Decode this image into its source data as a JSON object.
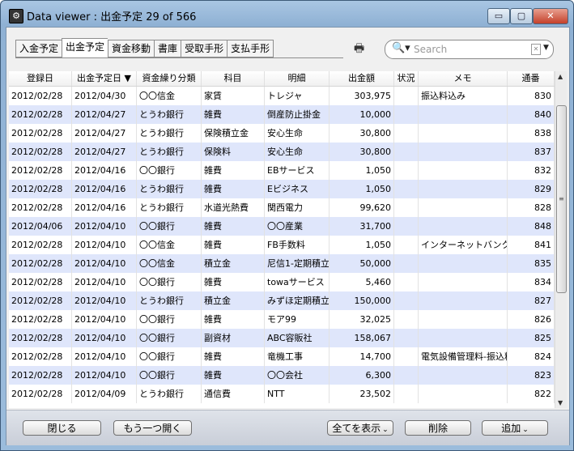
{
  "window": {
    "title": "Data viewer : 出金予定 29 of 566",
    "min_label": "▭",
    "max_label": "▢",
    "close_label": "✕"
  },
  "tabs": [
    "入金予定",
    "出金予定",
    "資金移動",
    "書庫",
    "受取手形",
    "支払手形"
  ],
  "active_tab": 1,
  "search": {
    "placeholder": "Search"
  },
  "columns": [
    "登録日",
    "出金予定日 ▼",
    "資金繰り分類",
    "科目",
    "明細",
    "出金額",
    "状況",
    "メモ",
    "通番"
  ],
  "rows": [
    [
      "2012/02/28",
      "2012/04/30",
      "〇〇信金",
      "家賃",
      "トレジャ",
      "303,975",
      "",
      "振込料込み",
      "830"
    ],
    [
      "2012/02/28",
      "2012/04/27",
      "とうわ銀行",
      "雑費",
      "倒産防止掛金",
      "10,000",
      "",
      "",
      "840"
    ],
    [
      "2012/02/28",
      "2012/04/27",
      "とうわ銀行",
      "保険積立金",
      "安心生命",
      "30,800",
      "",
      "",
      "838"
    ],
    [
      "2012/02/28",
      "2012/04/27",
      "とうわ銀行",
      "保険料",
      "安心生命",
      "30,800",
      "",
      "",
      "837"
    ],
    [
      "2012/02/28",
      "2012/04/16",
      "〇〇銀行",
      "雑費",
      "EBサービス",
      "1,050",
      "",
      "",
      "832"
    ],
    [
      "2012/02/28",
      "2012/04/16",
      "とうわ銀行",
      "雑費",
      "Eビジネス",
      "1,050",
      "",
      "",
      "829"
    ],
    [
      "2012/02/28",
      "2012/04/16",
      "とうわ銀行",
      "水道光熱費",
      "関西電力",
      "99,620",
      "",
      "",
      "828"
    ],
    [
      "2012/04/06",
      "2012/04/10",
      "〇〇銀行",
      "雑費",
      "〇〇産業",
      "31,700",
      "",
      "",
      "848"
    ],
    [
      "2012/02/28",
      "2012/04/10",
      "〇〇信金",
      "雑費",
      "FB手数料",
      "1,050",
      "",
      "インターネットバンク",
      "841"
    ],
    [
      "2012/02/28",
      "2012/04/10",
      "〇〇信金",
      "積立金",
      "尼信1-定期積立",
      "50,000",
      "",
      "",
      "835"
    ],
    [
      "2012/02/28",
      "2012/04/10",
      "〇〇銀行",
      "雑費",
      "towaサービス",
      "5,460",
      "",
      "",
      "834"
    ],
    [
      "2012/02/28",
      "2012/04/10",
      "とうわ銀行",
      "積立金",
      "みずほ定期積立",
      "150,000",
      "",
      "",
      "827"
    ],
    [
      "2012/02/28",
      "2012/04/10",
      "〇〇銀行",
      "雑費",
      "モア99",
      "32,025",
      "",
      "",
      "826"
    ],
    [
      "2012/02/28",
      "2012/04/10",
      "〇〇銀行",
      "副資材",
      "ABC容販社",
      "158,067",
      "",
      "",
      "825"
    ],
    [
      "2012/02/28",
      "2012/04/10",
      "〇〇銀行",
      "雑費",
      "竜機工事",
      "14,700",
      "",
      "電気設備管理料-振込料",
      "824"
    ],
    [
      "2012/02/28",
      "2012/04/10",
      "〇〇銀行",
      "雑費",
      "〇〇会社",
      "6,300",
      "",
      "",
      "823"
    ],
    [
      "2012/02/28",
      "2012/04/09",
      "とうわ銀行",
      "通信費",
      "NTT",
      "23,502",
      "",
      "",
      "822"
    ]
  ],
  "buttons": {
    "close": "閉じる",
    "open_another": "もう一つ開く",
    "show_all": "全てを表示",
    "delete": "削除",
    "add": "追加"
  }
}
